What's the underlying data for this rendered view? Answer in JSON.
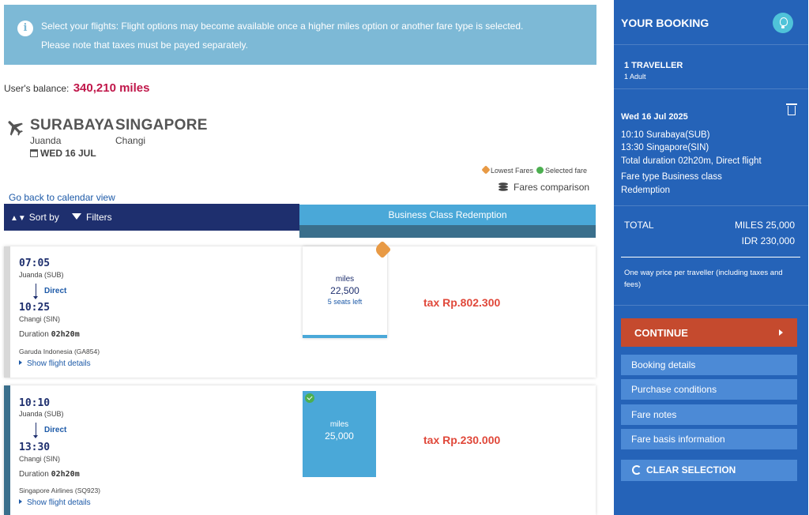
{
  "banner": {
    "line1": "Select your flights: Flight options may become available once a higher miles option or another fare type is selected.",
    "line2": "Please note that taxes must be payed separately.",
    "icon": "info-icon"
  },
  "balance": {
    "label": "User's balance:",
    "value": "340,210 miles"
  },
  "route": {
    "from": "SURABAYA",
    "to": "SINGAPORE",
    "from_sub": "Juanda",
    "to_sub": "Changi",
    "date": "WED 16 JUL"
  },
  "legend": {
    "lowest": "Lowest Fares",
    "selected": "Selected fare"
  },
  "fares_comparison": "Fares comparison",
  "back_link": "Go back to calendar view",
  "toolbar": {
    "sort": "Sort by",
    "filters": "Filters"
  },
  "column_header": "Business Class Redemption",
  "flights": [
    {
      "dep_time": "07:05",
      "dep_airport": "Juanda (SUB)",
      "direct": "Direct",
      "arr_time": "10:25",
      "arr_airport": "Changi (SIN)",
      "duration_label": "Duration",
      "duration": "02h20m",
      "airline": "Garuda Indonesia (GA854)",
      "details": "Show flight details",
      "fare": {
        "label": "miles",
        "amount": "22,500",
        "seats": "5 seats left"
      },
      "tax": "tax Rp.802.300"
    },
    {
      "dep_time": "10:10",
      "dep_airport": "Juanda (SUB)",
      "direct": "Direct",
      "arr_time": "13:30",
      "arr_airport": "Changi (SIN)",
      "duration_label": "Duration",
      "duration": "02h20m",
      "airline": "Singapore Airlines (SQ923)",
      "details": "Show flight details",
      "fare": {
        "label": "miles",
        "amount": "25,000"
      },
      "tax": "tax Rp.230.000"
    }
  ],
  "sidebar": {
    "title": "YOUR BOOKING",
    "travellers": "1 TRAVELLER",
    "adult": "1 Adult",
    "date": "Wed 16 Jul 2025",
    "dep": "10:10 Surabaya(SUB)",
    "arr": "13:30 Singapore(SIN)",
    "duration": "Total duration 02h20m, Direct flight",
    "fare_type": "Fare type Business class",
    "fare_type2": "Redemption",
    "total_label": "TOTAL",
    "total_miles": "MILES  25,000",
    "total_idr": "IDR 230,000",
    "note": "One way price per traveller (including taxes and fees)",
    "continue": "CONTINUE",
    "links": [
      "Booking details",
      "Purchase conditions",
      "Fare notes",
      "Fare basis information"
    ],
    "clear": "CLEAR SELECTION"
  },
  "colors": {
    "navy": "#1e2f6e",
    "accent_blue": "#4aa8d8",
    "sidebar_blue": "#2563b8",
    "miles_red": "#c0174a",
    "tax_red": "#e0483a",
    "continue_red": "#c54a2e",
    "banner": "#7db9d6"
  }
}
